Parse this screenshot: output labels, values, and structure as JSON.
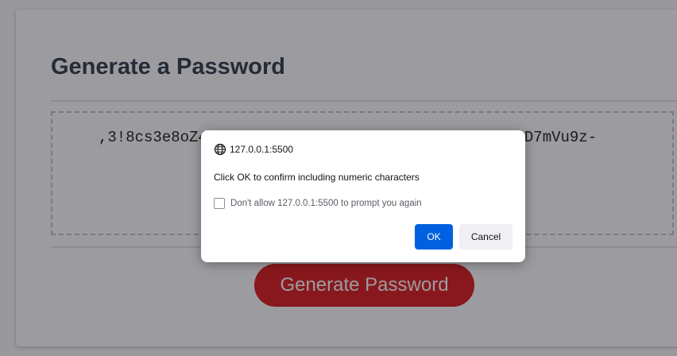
{
  "generator": {
    "title": "Generate a Password",
    "password": ",3!8cs3e8oZ4fR1#q7Wv!t2LpN6xY0kE9jTs4hU8dC3gA5bD7mVu9z-",
    "button_label": "Generate Password",
    "accent_color": "#dd1c1e"
  },
  "dialog": {
    "origin": "127.0.0.1:5500",
    "origin_icon": "globe-icon",
    "message": "Click OK to confirm including numeric characters",
    "checkbox_label": "Don't allow 127.0.0.1:5500 to prompt you again",
    "checkbox_checked": false,
    "ok_label": "OK",
    "cancel_label": "Cancel",
    "ok_color": "#0061e0"
  }
}
